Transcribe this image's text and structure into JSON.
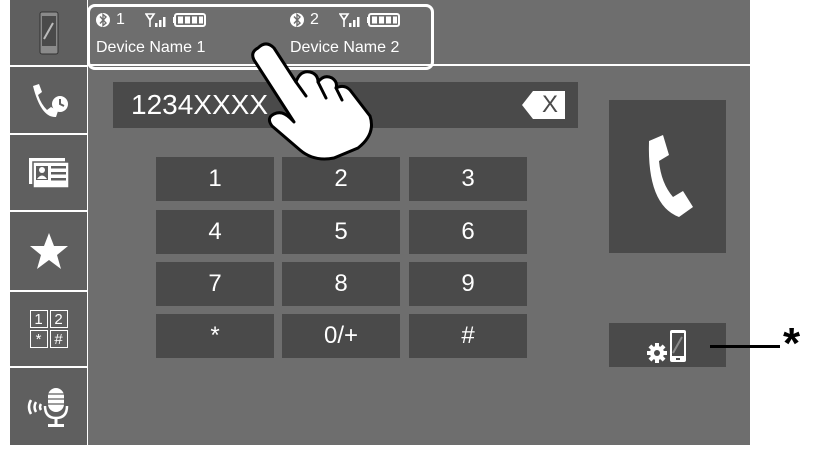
{
  "status": {
    "devices": [
      {
        "bt_number": "1",
        "name": "Device Name 1"
      },
      {
        "bt_number": "2",
        "name": "Device Name 2"
      }
    ]
  },
  "dialer": {
    "number": "1234XXXX",
    "backspace_label": "X",
    "keys": [
      "1",
      "2",
      "3",
      "4",
      "5",
      "6",
      "7",
      "8",
      "9",
      "*",
      "0/+",
      "#"
    ]
  },
  "sidebar": {
    "items": [
      {
        "icon": "phone-device-icon"
      },
      {
        "icon": "call-history-icon"
      },
      {
        "icon": "phonebook-icon"
      },
      {
        "icon": "favorites-star-icon"
      },
      {
        "icon": "dial-keypad-icon",
        "labels": [
          "1",
          "2",
          "*",
          "#"
        ]
      },
      {
        "icon": "voice-recognition-icon"
      }
    ]
  },
  "callout": {
    "symbol": "*"
  },
  "colors": {
    "screen": "#6e6e6e",
    "button": "#4a4a4a",
    "text": "#ffffff"
  }
}
